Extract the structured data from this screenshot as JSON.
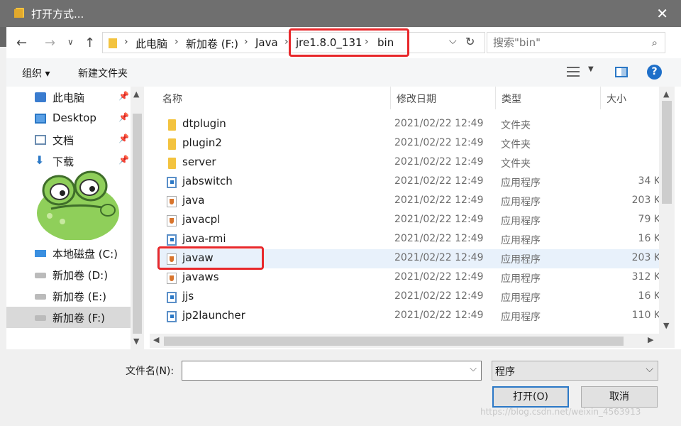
{
  "window": {
    "title": "打开方式...",
    "close": "✕"
  },
  "address": {
    "crumbs": [
      "此电脑",
      "新加卷 (F:)",
      "Java",
      "jre1.8.0_131",
      "bin"
    ],
    "sep": "›",
    "search_placeholder": "搜索\"bin\""
  },
  "toolbar": {
    "organize": "组织 ▾",
    "new_folder": "新建文件夹",
    "help": "?"
  },
  "sidebar": {
    "items": [
      {
        "label": "此电脑",
        "pinned": true
      },
      {
        "label": "Desktop",
        "pinned": true
      },
      {
        "label": "文档",
        "pinned": true
      },
      {
        "label": "下载",
        "pinned": true
      },
      {
        "label": "本地磁盘 (C:)"
      },
      {
        "label": "新加卷 (D:)"
      },
      {
        "label": "新加卷 (E:)"
      },
      {
        "label": "新加卷 (F:)",
        "selected": true
      }
    ]
  },
  "columns": {
    "name": "名称",
    "date": "修改日期",
    "type": "类型",
    "size": "大小"
  },
  "files": [
    {
      "name": "dtplugin",
      "date": "2021/02/22 12:49",
      "type": "文件夹",
      "size": "",
      "icon": "folder"
    },
    {
      "name": "plugin2",
      "date": "2021/02/22 12:49",
      "type": "文件夹",
      "size": "",
      "icon": "folder"
    },
    {
      "name": "server",
      "date": "2021/02/22 12:49",
      "type": "文件夹",
      "size": "",
      "icon": "folder"
    },
    {
      "name": "jabswitch",
      "date": "2021/02/22 12:49",
      "type": "应用程序",
      "size": "34 K",
      "icon": "exe"
    },
    {
      "name": "java",
      "date": "2021/02/22 12:49",
      "type": "应用程序",
      "size": "203 K",
      "icon": "java"
    },
    {
      "name": "javacpl",
      "date": "2021/02/22 12:49",
      "type": "应用程序",
      "size": "79 K",
      "icon": "java"
    },
    {
      "name": "java-rmi",
      "date": "2021/02/22 12:49",
      "type": "应用程序",
      "size": "16 K",
      "icon": "exe"
    },
    {
      "name": "javaw",
      "date": "2021/02/22 12:49",
      "type": "应用程序",
      "size": "203 K",
      "icon": "java"
    },
    {
      "name": "javaws",
      "date": "2021/02/22 12:49",
      "type": "应用程序",
      "size": "312 K",
      "icon": "java"
    },
    {
      "name": "jjs",
      "date": "2021/02/22 12:49",
      "type": "应用程序",
      "size": "16 K",
      "icon": "exe"
    },
    {
      "name": "jp2launcher",
      "date": "2021/02/22 12:49",
      "type": "应用程序",
      "size": "110 K",
      "icon": "exe"
    }
  ],
  "bottom": {
    "filename_label": "文件名(N):",
    "filename_value": "",
    "filetype": "程序",
    "open": "打开(O)",
    "cancel": "取消",
    "watermark": "https://blog.csdn.net/weixin_4563913"
  }
}
